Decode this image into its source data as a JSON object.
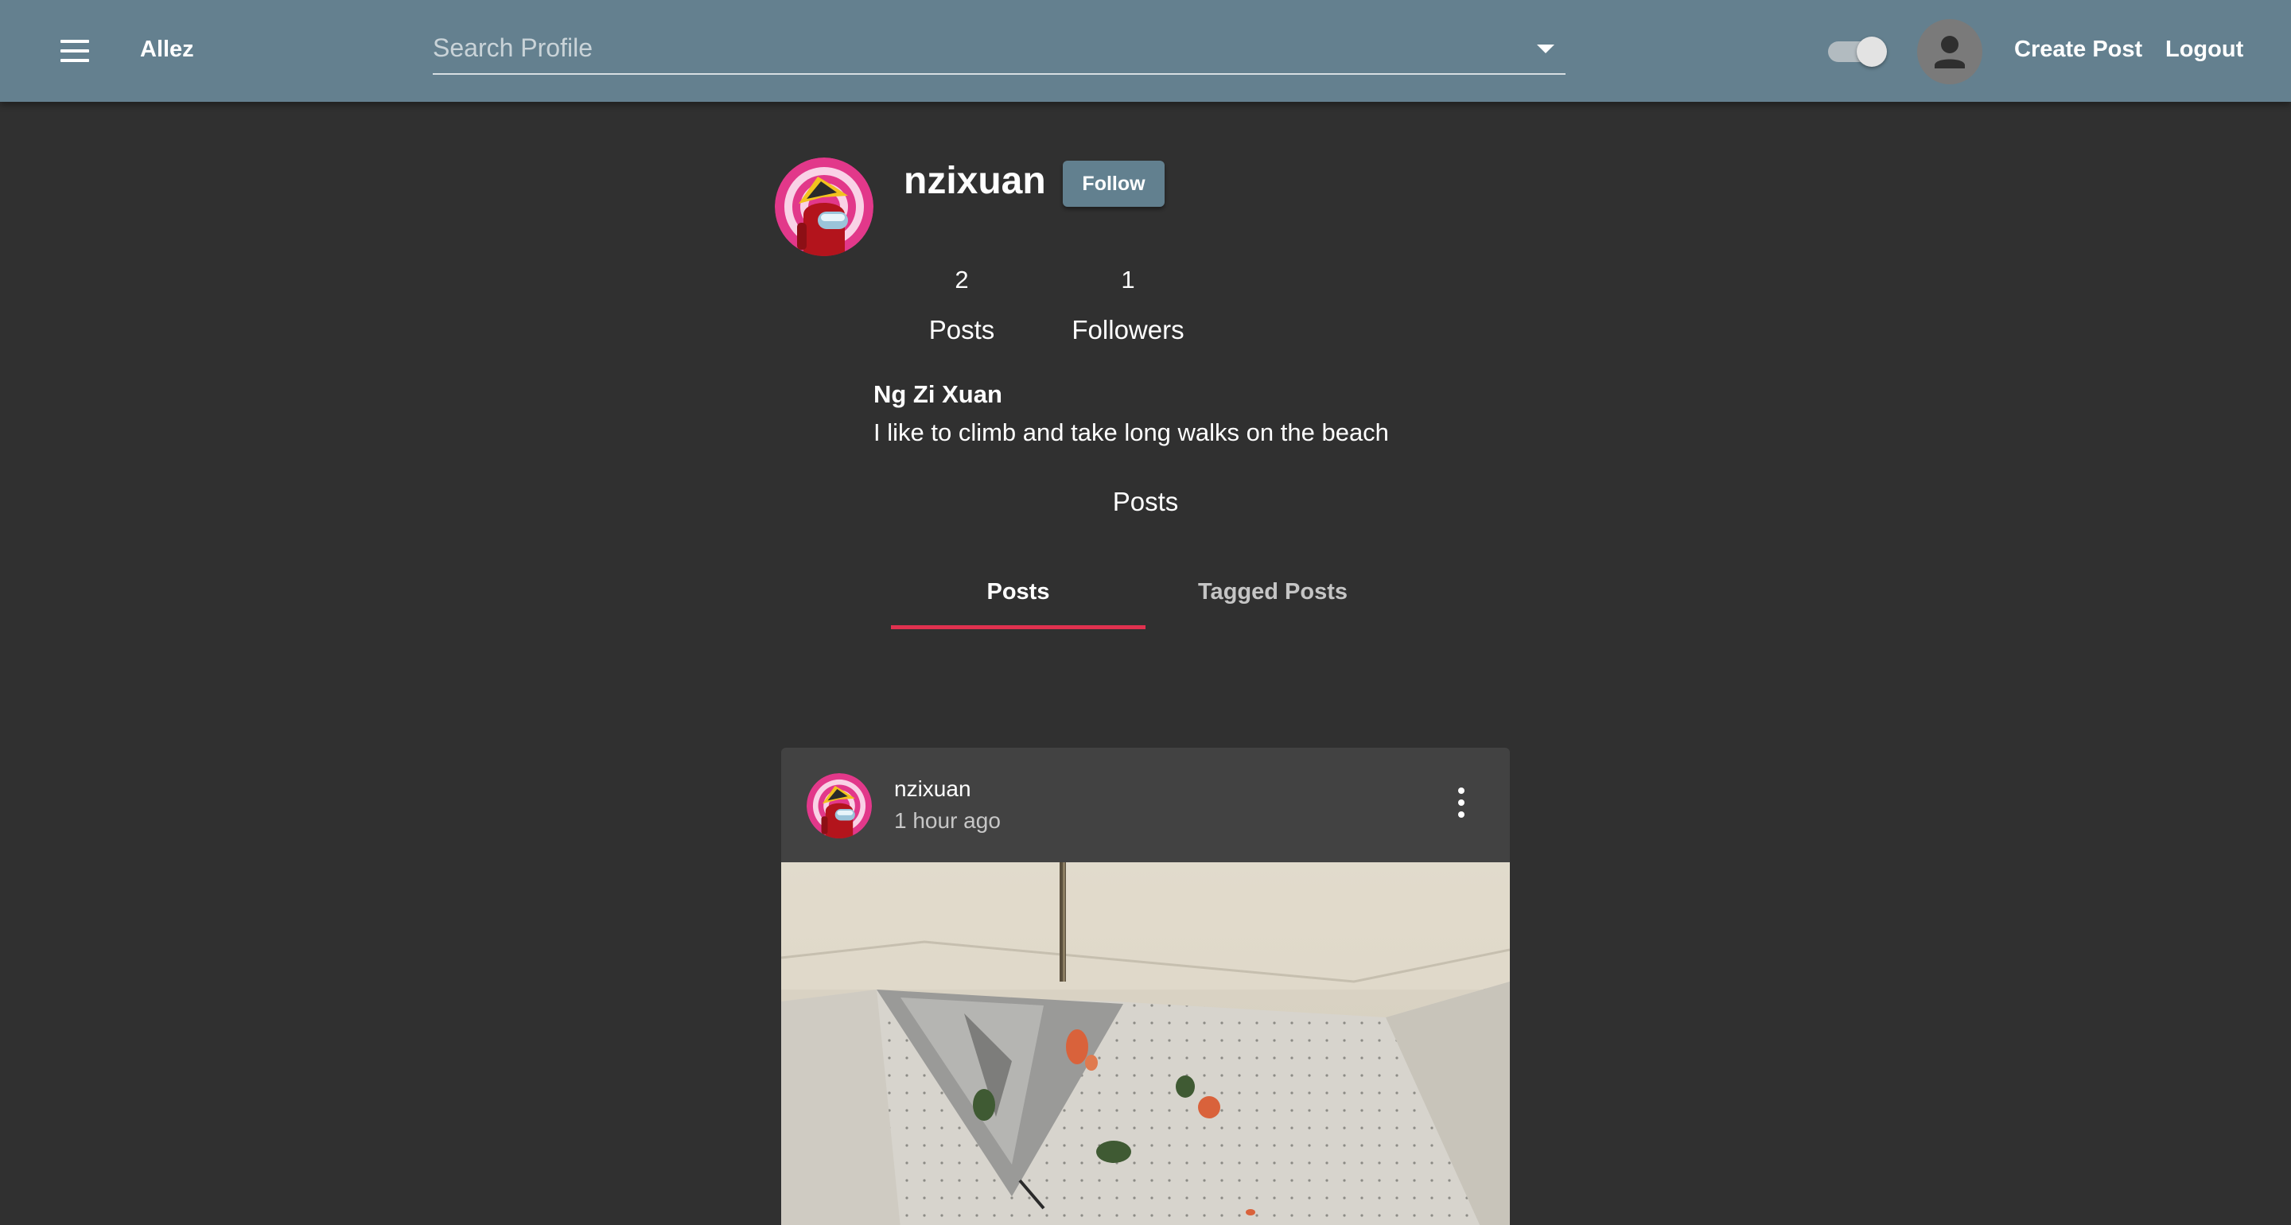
{
  "app_bar": {
    "brand": "Allez",
    "search_placeholder": "Search Profile",
    "create_post_label": "Create Post",
    "logout_label": "Logout",
    "background_color": "#64808f",
    "theme_toggle_on": true
  },
  "profile": {
    "username": "nzixuan",
    "follow_label": "Follow",
    "stats": {
      "posts_count": "2",
      "posts_label": "Posts",
      "followers_count": "1",
      "followers_label": "Followers"
    },
    "full_name": "Ng Zi Xuan",
    "bio": "I like to climb and take long walks on the beach",
    "posts_heading": "Posts"
  },
  "tabs": [
    {
      "label": "Posts",
      "active": true
    },
    {
      "label": "Tagged Posts",
      "active": false
    }
  ],
  "accent_color": "#e0314f",
  "post": {
    "username": "nzixuan",
    "time": "1 hour ago"
  }
}
